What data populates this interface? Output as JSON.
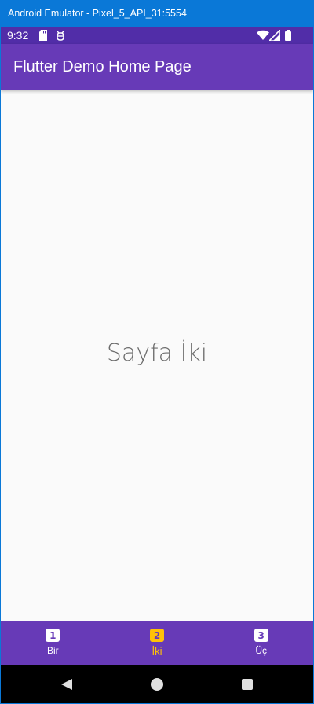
{
  "window": {
    "title": "Android Emulator - Pixel_5_API_31:5554"
  },
  "status_bar": {
    "time": "9:32",
    "icons": [
      "sd-card-icon",
      "debug-icon",
      "wifi-icon",
      "signal-icon",
      "battery-icon"
    ]
  },
  "app_bar": {
    "title": "Flutter Demo Home Page"
  },
  "body": {
    "text": "Sayfa İki"
  },
  "bottom_nav": {
    "selected_index": 1,
    "items": [
      {
        "label": "Bir",
        "badge": "1"
      },
      {
        "label": "İki",
        "badge": "2"
      },
      {
        "label": "Üç",
        "badge": "3"
      }
    ]
  },
  "colors": {
    "primary": "#673ab7",
    "primary_dark": "#512da8",
    "accent": "#ffc107",
    "window_chrome": "#0a78d7"
  },
  "system_nav": {
    "icons": [
      "back-icon",
      "home-icon",
      "recents-icon"
    ]
  }
}
